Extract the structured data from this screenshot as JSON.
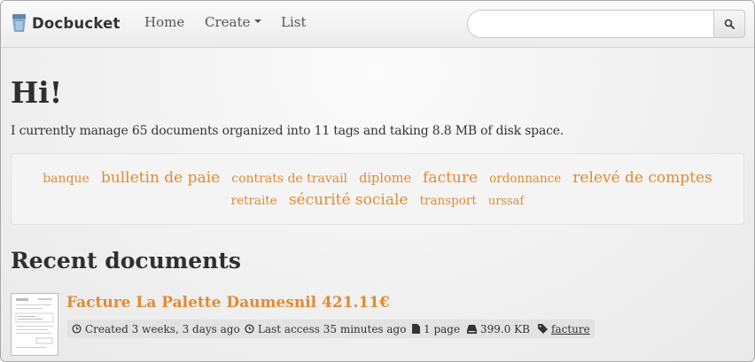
{
  "navbar": {
    "brand": "Docbucket",
    "links": {
      "home": "Home",
      "create": "Create",
      "list": "List"
    },
    "search": {
      "value": "",
      "placeholder": ""
    }
  },
  "main": {
    "greeting": "Hi!",
    "intro": "I currently manage 65 documents organized into 11 tags and taking 8.8 MB of disk space."
  },
  "tag_cloud": {
    "tags": [
      "banque",
      "bulletin de paie",
      "contrats de travail",
      "diplome",
      "facture",
      "ordonnance",
      "relevé de comptes",
      "retraite",
      "sécurité sociale",
      "transport",
      "urssaf"
    ]
  },
  "recent": {
    "heading": "Recent documents",
    "documents": [
      {
        "title": "Facture La Palette Daumesnil 421.11€",
        "created": "Created 3 weeks, 3 days ago",
        "last_access": "Last access 35 minutes ago",
        "pages": "1 page",
        "size": "399.0 KB",
        "tag": "facture"
      }
    ]
  },
  "colors": {
    "accent": "#e08a33",
    "text": "#333333"
  }
}
